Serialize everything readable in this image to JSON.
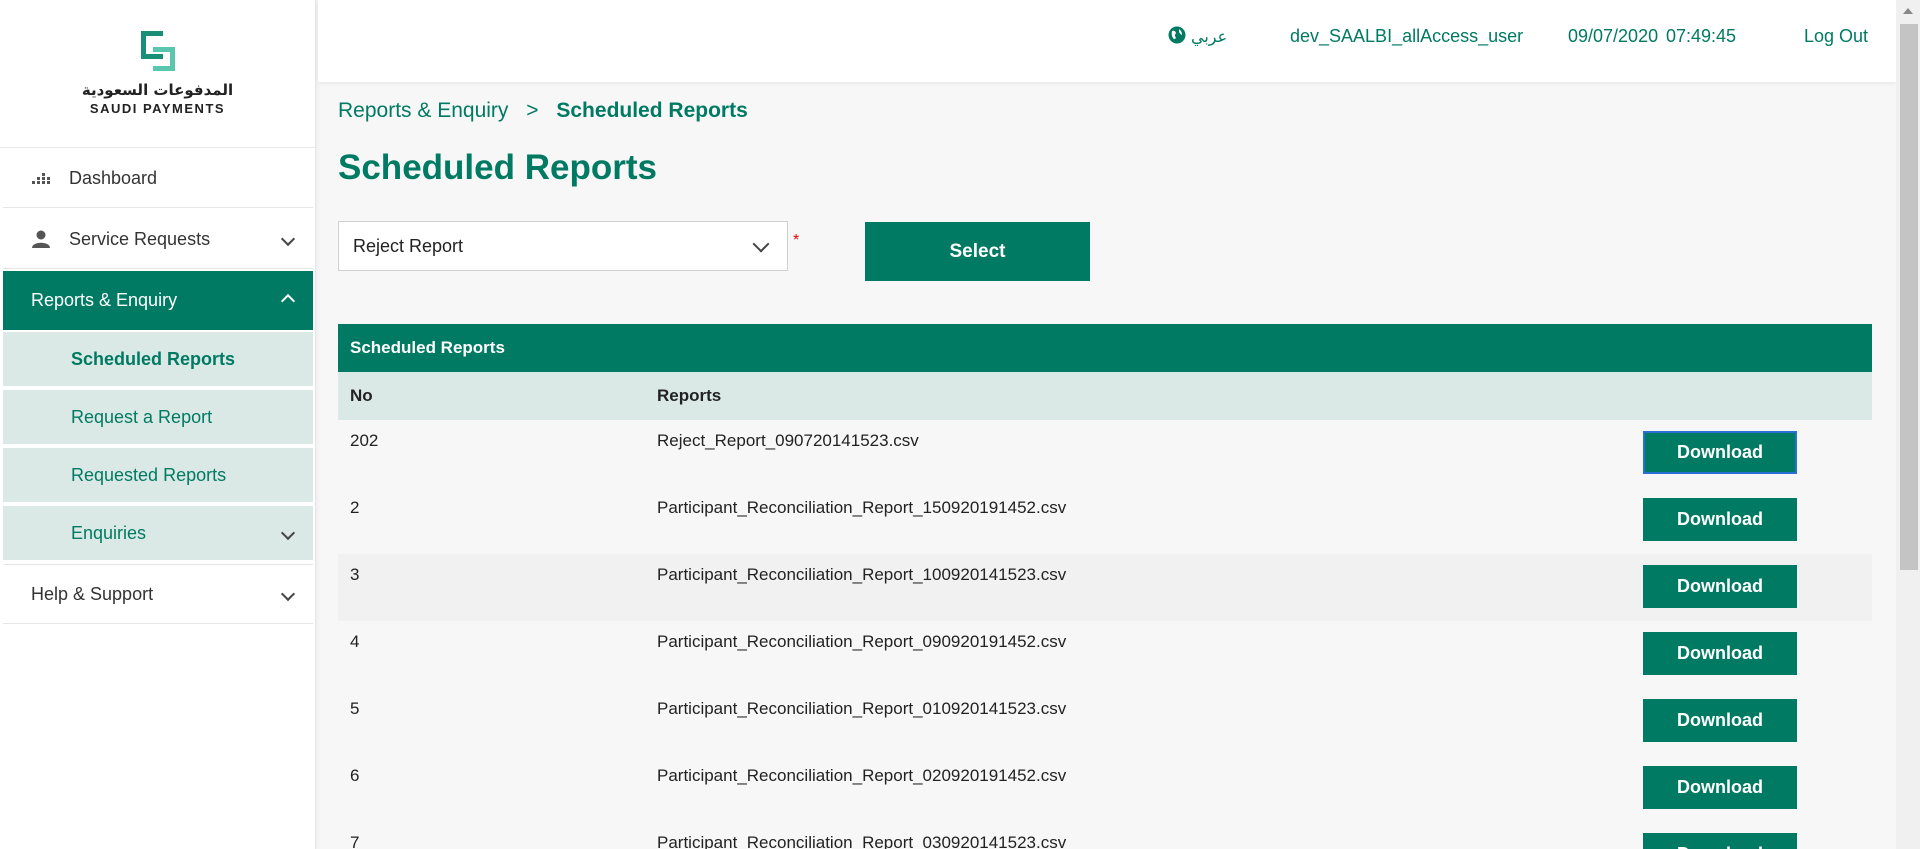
{
  "brand": {
    "arabic": "المدفوعات السعودية",
    "english": "SAUDI PAYMENTS"
  },
  "header": {
    "language": "عربي",
    "username": "dev_SAALBI_allAccess_user",
    "date": "09/07/2020",
    "time": "07:49:45",
    "logout": "Log Out"
  },
  "sidebar": {
    "dashboard": "Dashboard",
    "service_requests": "Service Requests",
    "reports_enquiry": "Reports & Enquiry",
    "scheduled_reports": "Scheduled Reports",
    "request_report": "Request a Report",
    "requested_reports": "Requested Reports",
    "enquiries": "Enquiries",
    "help_support": "Help & Support"
  },
  "breadcrumb": {
    "parent": "Reports & Enquiry",
    "separator": ">",
    "current": "Scheduled Reports"
  },
  "page_title": "Scheduled Reports",
  "form": {
    "report_type": "Reject Report",
    "required_mark": "*",
    "select_label": "Select"
  },
  "table": {
    "caption": "Scheduled Reports",
    "columns": [
      "No",
      "Reports"
    ],
    "download_label": "Download",
    "rows": [
      {
        "no": "202",
        "file": "Reject_Report_090720141523.csv"
      },
      {
        "no": "2",
        "file": "Participant_Reconciliation_Report_150920191452.csv"
      },
      {
        "no": "3",
        "file": "Participant_Reconciliation_Report_100920141523.csv"
      },
      {
        "no": "4",
        "file": "Participant_Reconciliation_Report_090920191452.csv"
      },
      {
        "no": "5",
        "file": "Participant_Reconciliation_Report_010920141523.csv"
      },
      {
        "no": "6",
        "file": "Participant_Reconciliation_Report_020920191452.csv"
      },
      {
        "no": "7",
        "file": "Participant_Reconciliation_Report_030920141523.csv"
      }
    ]
  },
  "colors": {
    "primary": "#007a62",
    "sub_nav_bg": "#dae9e6",
    "required": "#ee0000"
  },
  "icons": [
    "dashboard-icon",
    "user-icon",
    "globe-icon",
    "chevron-down-icon",
    "chevron-up-icon"
  ]
}
